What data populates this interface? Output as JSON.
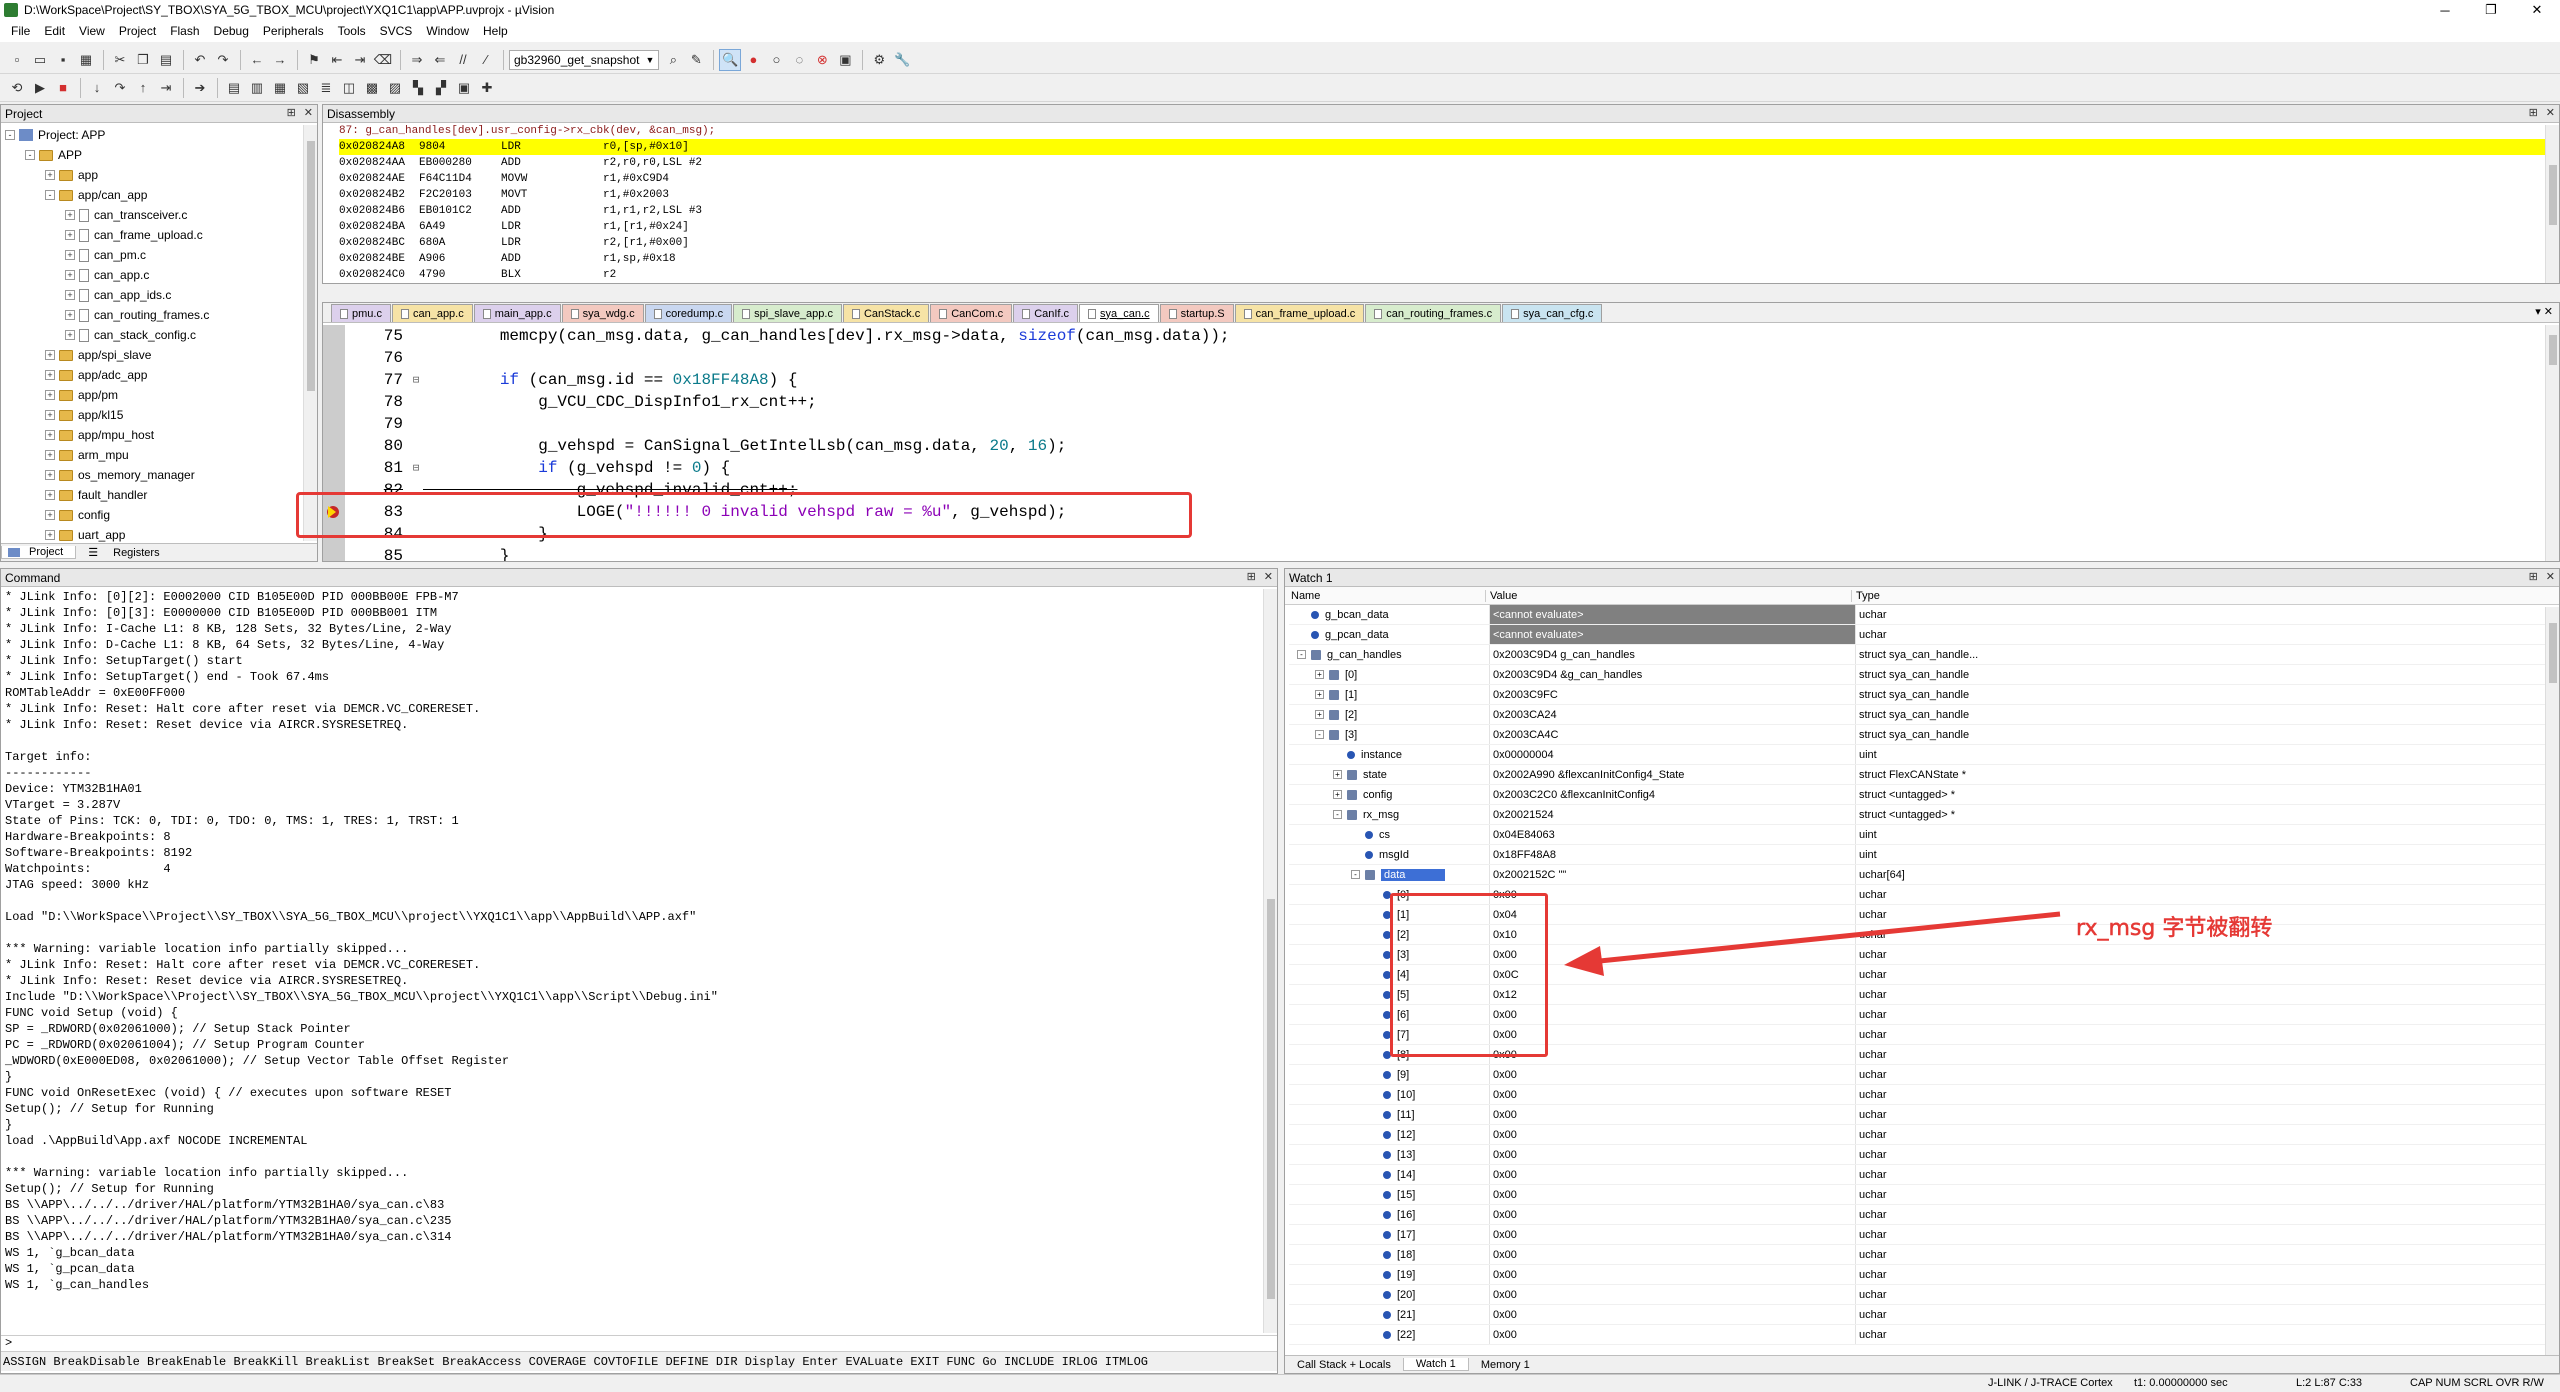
{
  "titlebar": {
    "title": "D:\\WorkSpace\\Project\\SY_TBOX\\SYA_5G_TBOX_MCU\\project\\YXQ1C1\\app\\APP.uvprojx - µVision",
    "minimize": "─",
    "maximize": "❐",
    "close": "✕"
  },
  "menu": [
    "File",
    "Edit",
    "View",
    "Project",
    "Flash",
    "Debug",
    "Peripherals",
    "Tools",
    "SVCS",
    "Window",
    "Help"
  ],
  "toolbar": {
    "target": "gb32960_get_snapshot"
  },
  "project_panel": {
    "title": "Project",
    "tree": [
      {
        "label": "Project: APP",
        "level": 0,
        "kind": "project",
        "exp": "-"
      },
      {
        "label": "APP",
        "level": 1,
        "kind": "folder",
        "exp": "-"
      },
      {
        "label": "app",
        "level": 2,
        "kind": "folder",
        "exp": "+"
      },
      {
        "label": "app/can_app",
        "level": 2,
        "kind": "folder",
        "exp": "-"
      },
      {
        "label": "can_transceiver.c",
        "level": 3,
        "kind": "file",
        "exp": "+"
      },
      {
        "label": "can_frame_upload.c",
        "level": 3,
        "kind": "file",
        "exp": "+"
      },
      {
        "label": "can_pm.c",
        "level": 3,
        "kind": "file",
        "exp": "+"
      },
      {
        "label": "can_app.c",
        "level": 3,
        "kind": "file",
        "exp": "+"
      },
      {
        "label": "can_app_ids.c",
        "level": 3,
        "kind": "file",
        "exp": "+"
      },
      {
        "label": "can_routing_frames.c",
        "level": 3,
        "kind": "file",
        "exp": "+"
      },
      {
        "label": "can_stack_config.c",
        "level": 3,
        "kind": "file",
        "exp": "+"
      },
      {
        "label": "app/spi_slave",
        "level": 2,
        "kind": "folder",
        "exp": "+"
      },
      {
        "label": "app/adc_app",
        "level": 2,
        "kind": "folder",
        "exp": "+"
      },
      {
        "label": "app/pm",
        "level": 2,
        "kind": "folder",
        "exp": "+"
      },
      {
        "label": "app/kl15",
        "level": 2,
        "kind": "folder",
        "exp": "+"
      },
      {
        "label": "app/mpu_host",
        "level": 2,
        "kind": "folder",
        "exp": "+"
      },
      {
        "label": "arm_mpu",
        "level": 2,
        "kind": "folder",
        "exp": "+"
      },
      {
        "label": "os_memory_manager",
        "level": 2,
        "kind": "folder",
        "exp": "+"
      },
      {
        "label": "fault_handler",
        "level": 2,
        "kind": "folder",
        "exp": "+"
      },
      {
        "label": "config",
        "level": 2,
        "kind": "folder",
        "exp": "+"
      },
      {
        "label": "uart_app",
        "level": 2,
        "kind": "folder",
        "exp": "+"
      }
    ],
    "tabs": [
      "Project",
      "Registers"
    ]
  },
  "disassembly": {
    "title": "Disassembly",
    "source_line": "    87:           g_can_handles[dev].usr_config->rx_cbk(dev, &can_msg);",
    "rows": [
      {
        "addr": "0x020824A8",
        "op": "9804",
        "mn": "LDR",
        "args": "r0,[sp,#0x10]",
        "hl": true
      },
      {
        "addr": "0x020824AA",
        "op": "EB000280",
        "mn": "ADD",
        "args": "r2,r0,r0,LSL #2",
        "hl": false
      },
      {
        "addr": "0x020824AE",
        "op": "F64C11D4",
        "mn": "MOVW",
        "args": "r1,#0xC9D4",
        "hl": false
      },
      {
        "addr": "0x020824B2",
        "op": "F2C20103",
        "mn": "MOVT",
        "args": "r1,#0x2003",
        "hl": false
      },
      {
        "addr": "0x020824B6",
        "op": "EB0101C2",
        "mn": "ADD",
        "args": "r1,r1,r2,LSL #3",
        "hl": false
      },
      {
        "addr": "0x020824BA",
        "op": "6A49",
        "mn": "LDR",
        "args": "r1,[r1,#0x24]",
        "hl": false
      },
      {
        "addr": "0x020824BC",
        "op": "680A",
        "mn": "LDR",
        "args": "r2,[r1,#0x00]",
        "hl": false
      },
      {
        "addr": "0x020824BE",
        "op": "A906",
        "mn": "ADD",
        "args": "r1,sp,#0x18",
        "hl": false
      },
      {
        "addr": "0x020824C0",
        "op": "4790",
        "mn": "BLX",
        "args": "r2",
        "hl": false
      }
    ]
  },
  "editor": {
    "tabs": [
      {
        "label": "pmu.c",
        "color": "#dcd0ec"
      },
      {
        "label": "can_app.c",
        "color": "#f6e3a6"
      },
      {
        "label": "main_app.c",
        "color": "#dcd0ec"
      },
      {
        "label": "sya_wdg.c",
        "color": "#f3c9c0"
      },
      {
        "label": "coredump.c",
        "color": "#c9d7f0"
      },
      {
        "label": "spi_slave_app.c",
        "color": "#d7eccd"
      },
      {
        "label": "CanStack.c",
        "color": "#f6e3a6"
      },
      {
        "label": "CanCom.c",
        "color": "#f3c9c0"
      },
      {
        "label": "CanIf.c",
        "color": "#dcd0ec"
      },
      {
        "label": "sya_can.c",
        "color": "#e8e8e8",
        "active": true
      },
      {
        "label": "startup.S",
        "color": "#f3c9c0"
      },
      {
        "label": "can_frame_upload.c",
        "color": "#f6e3a6"
      },
      {
        "label": "can_routing_frames.c",
        "color": "#d7eccd"
      },
      {
        "label": "sya_can_cfg.c",
        "color": "#c9e4f0"
      }
    ],
    "lines": [
      {
        "n": "75",
        "fold": "",
        "code": [
          [
            "        memcpy(can_msg.data, g_can_handles[dev].rx_msg->data, ",
            ""
          ],
          [
            "sizeof",
            "kw"
          ],
          [
            "(can_msg.data));",
            ""
          ]
        ]
      },
      {
        "n": "76",
        "fold": "",
        "code": [
          [
            "",
            ""
          ]
        ]
      },
      {
        "n": "77",
        "fold": "⊟",
        "code": [
          [
            "        ",
            ""
          ],
          [
            "if",
            "kw"
          ],
          [
            " (can_msg.id == ",
            ""
          ],
          [
            "0x18FF48A8",
            "num"
          ],
          [
            ") {",
            ""
          ]
        ]
      },
      {
        "n": "78",
        "fold": "",
        "code": [
          [
            "            g_VCU_CDC_DispInfo1_rx_cnt++;",
            ""
          ]
        ]
      },
      {
        "n": "79",
        "fold": "",
        "code": [
          [
            "",
            ""
          ]
        ]
      },
      {
        "n": "80",
        "fold": "",
        "code": [
          [
            "            g_vehspd = CanSignal_GetIntelLsb(can_msg.data, ",
            ""
          ],
          [
            "20",
            "num"
          ],
          [
            ", ",
            ""
          ],
          [
            "16",
            "num"
          ],
          [
            ");",
            ""
          ]
        ]
      },
      {
        "n": "81",
        "fold": "⊟",
        "code": [
          [
            "            ",
            ""
          ],
          [
            "if",
            "kw"
          ],
          [
            " (g_vehspd != ",
            ""
          ],
          [
            "0",
            "num"
          ],
          [
            ") {",
            ""
          ]
        ]
      },
      {
        "n": "82",
        "fold": "",
        "code": [
          [
            "                g_vehspd_invalid_cnt++;",
            ""
          ]
        ]
      },
      {
        "n": "83",
        "fold": "",
        "code": [
          [
            "                LOGE(",
            ""
          ],
          [
            "\"!!!!!! 0 invalid vehspd raw = %u\"",
            "str"
          ],
          [
            ", g_vehspd);",
            ""
          ]
        ]
      },
      {
        "n": "84",
        "fold": "",
        "code": [
          [
            "            }",
            ""
          ]
        ]
      },
      {
        "n": "85",
        "fold": "",
        "code": [
          [
            "        }",
            ""
          ]
        ]
      }
    ]
  },
  "command": {
    "title": "Command",
    "lines": [
      "* JLink Info: [0][2]: E0002000 CID B105E00D PID 000BB00E FPB-M7",
      "* JLink Info: [0][3]: E0000000 CID B105E00D PID 000BB001 ITM",
      "* JLink Info: I-Cache L1: 8 KB, 128 Sets, 32 Bytes/Line, 2-Way",
      "* JLink Info: D-Cache L1: 8 KB, 64 Sets, 32 Bytes/Line, 4-Way",
      "* JLink Info: SetupTarget() start",
      "* JLink Info: SetupTarget() end - Took 67.4ms",
      "ROMTableAddr = 0xE00FF000",
      "* JLink Info: Reset: Halt core after reset via DEMCR.VC_CORERESET.",
      "* JLink Info: Reset: Reset device via AIRCR.SYSRESETREQ.",
      "",
      "Target info:",
      "------------",
      "Device: YTM32B1HA01",
      "VTarget = 3.287V",
      "State of Pins: TCK: 0, TDI: 0, TDO: 0, TMS: 1, TRES: 1, TRST: 1",
      "Hardware-Breakpoints: 8",
      "Software-Breakpoints: 8192",
      "Watchpoints:          4",
      "JTAG speed: 3000 kHz",
      "",
      "Load \"D:\\\\WorkSpace\\\\Project\\\\SY_TBOX\\\\SYA_5G_TBOX_MCU\\\\project\\\\YXQ1C1\\\\app\\\\AppBuild\\\\APP.axf\"",
      "",
      "*** Warning: variable location info partially skipped...",
      "* JLink Info: Reset: Halt core after reset via DEMCR.VC_CORERESET.",
      "* JLink Info: Reset: Reset device via AIRCR.SYSRESETREQ.",
      "Include \"D:\\\\WorkSpace\\\\Project\\\\SY_TBOX\\\\SYA_5G_TBOX_MCU\\\\project\\\\YXQ1C1\\\\app\\\\Script\\\\Debug.ini\"",
      "FUNC void Setup (void) {",
      "SP = _RDWORD(0x02061000); // Setup Stack Pointer",
      "PC = _RDWORD(0x02061004); // Setup Program Counter",
      "_WDWORD(0xE000ED08, 0x02061000); // Setup Vector Table Offset Register",
      "}",
      "FUNC void OnResetExec (void) { // executes upon software RESET",
      "Setup(); // Setup for Running",
      "}",
      "load .\\AppBuild\\App.axf NOCODE INCREMENTAL",
      "",
      "*** Warning: variable location info partially skipped...",
      "Setup(); // Setup for Running",
      "BS \\\\APP\\../../../driver/HAL/platform/YTM32B1HA0/sya_can.c\\83",
      "BS \\\\APP\\../../../driver/HAL/platform/YTM32B1HA0/sya_can.c\\235",
      "BS \\\\APP\\../../../driver/HAL/platform/YTM32B1HA0/sya_can.c\\314",
      "WS 1, `g_bcan_data",
      "WS 1, `g_pcan_data",
      "WS 1, `g_can_handles"
    ],
    "prompt": ">",
    "hint": "ASSIGN BreakDisable BreakEnable BreakKill BreakList BreakSet BreakAccess COVERAGE COVTOFILE DEFINE DIR Display Enter EVALuate EXIT FUNC Go INCLUDE IRLOG ITMLOG"
  },
  "watch": {
    "title": "Watch 1",
    "headers": [
      "Name",
      "Value",
      "Type"
    ],
    "rows": [
      {
        "name": "g_bcan_data",
        "value": "<cannot evaluate>",
        "type": "uchar",
        "lvl": 0,
        "exp": "",
        "icon": "d",
        "grey": true
      },
      {
        "name": "g_pcan_data",
        "value": "<cannot evaluate>",
        "type": "uchar",
        "lvl": 0,
        "exp": "",
        "icon": "d",
        "grey": true
      },
      {
        "name": "g_can_handles",
        "value": "0x2003C9D4 g_can_handles",
        "type": "struct sya_can_handle...",
        "lvl": 0,
        "exp": "-",
        "icon": "s"
      },
      {
        "name": "[0]",
        "value": "0x2003C9D4 &g_can_handles",
        "type": "struct sya_can_handle",
        "lvl": 1,
        "exp": "+",
        "icon": "s"
      },
      {
        "name": "[1]",
        "value": "0x2003C9FC",
        "type": "struct sya_can_handle",
        "lvl": 1,
        "exp": "+",
        "icon": "s"
      },
      {
        "name": "[2]",
        "value": "0x2003CA24",
        "type": "struct sya_can_handle",
        "lvl": 1,
        "exp": "+",
        "icon": "s"
      },
      {
        "name": "[3]",
        "value": "0x2003CA4C",
        "type": "struct sya_can_handle",
        "lvl": 1,
        "exp": "-",
        "icon": "s"
      },
      {
        "name": "instance",
        "value": "0x00000004",
        "type": "uint",
        "lvl": 2,
        "exp": "",
        "icon": "d"
      },
      {
        "name": "state",
        "value": "0x2002A990 &flexcanInitConfig4_State",
        "type": "struct FlexCANState *",
        "lvl": 2,
        "exp": "+",
        "icon": "s"
      },
      {
        "name": "config",
        "value": "0x2003C2C0 &flexcanInitConfig4",
        "type": "struct <untagged> *",
        "lvl": 2,
        "exp": "+",
        "icon": "s"
      },
      {
        "name": "rx_msg",
        "value": "0x20021524",
        "type": "struct <untagged> *",
        "lvl": 2,
        "exp": "-",
        "icon": "s"
      },
      {
        "name": "cs",
        "value": "0x04E84063",
        "type": "uint",
        "lvl": 3,
        "exp": "",
        "icon": "d"
      },
      {
        "name": "msgId",
        "value": "0x18FF48A8",
        "type": "uint",
        "lvl": 3,
        "exp": "",
        "icon": "d"
      },
      {
        "name": "data",
        "value": "0x2002152C \"\"",
        "type": "uchar[64]",
        "lvl": 3,
        "exp": "-",
        "icon": "s",
        "sel": true
      },
      {
        "name": "[0]",
        "value": "0x00",
        "type": "uchar",
        "lvl": 4,
        "exp": "",
        "icon": "d"
      },
      {
        "name": "[1]",
        "value": "0x04",
        "type": "uchar",
        "lvl": 4,
        "exp": "",
        "icon": "d"
      },
      {
        "name": "[2]",
        "value": "0x10",
        "type": "uchar",
        "lvl": 4,
        "exp": "",
        "icon": "d"
      },
      {
        "name": "[3]",
        "value": "0x00",
        "type": "uchar",
        "lvl": 4,
        "exp": "",
        "icon": "d"
      },
      {
        "name": "[4]",
        "value": "0x0C",
        "type": "uchar",
        "lvl": 4,
        "exp": "",
        "icon": "d"
      },
      {
        "name": "[5]",
        "value": "0x12",
        "type": "uchar",
        "lvl": 4,
        "exp": "",
        "icon": "d"
      },
      {
        "name": "[6]",
        "value": "0x00",
        "type": "uchar",
        "lvl": 4,
        "exp": "",
        "icon": "d"
      },
      {
        "name": "[7]",
        "value": "0x00",
        "type": "uchar",
        "lvl": 4,
        "exp": "",
        "icon": "d"
      },
      {
        "name": "[8]",
        "value": "0x00",
        "type": "uchar",
        "lvl": 4,
        "exp": "",
        "icon": "d"
      },
      {
        "name": "[9]",
        "value": "0x00",
        "type": "uchar",
        "lvl": 4,
        "exp": "",
        "icon": "d"
      },
      {
        "name": "[10]",
        "value": "0x00",
        "type": "uchar",
        "lvl": 4,
        "exp": "",
        "icon": "d"
      },
      {
        "name": "[11]",
        "value": "0x00",
        "type": "uchar",
        "lvl": 4,
        "exp": "",
        "icon": "d"
      },
      {
        "name": "[12]",
        "value": "0x00",
        "type": "uchar",
        "lvl": 4,
        "exp": "",
        "icon": "d"
      },
      {
        "name": "[13]",
        "value": "0x00",
        "type": "uchar",
        "lvl": 4,
        "exp": "",
        "icon": "d"
      },
      {
        "name": "[14]",
        "value": "0x00",
        "type": "uchar",
        "lvl": 4,
        "exp": "",
        "icon": "d"
      },
      {
        "name": "[15]",
        "value": "0x00",
        "type": "uchar",
        "lvl": 4,
        "exp": "",
        "icon": "d"
      },
      {
        "name": "[16]",
        "value": "0x00",
        "type": "uchar",
        "lvl": 4,
        "exp": "",
        "icon": "d"
      },
      {
        "name": "[17]",
        "value": "0x00",
        "type": "uchar",
        "lvl": 4,
        "exp": "",
        "icon": "d"
      },
      {
        "name": "[18]",
        "value": "0x00",
        "type": "uchar",
        "lvl": 4,
        "exp": "",
        "icon": "d"
      },
      {
        "name": "[19]",
        "value": "0x00",
        "type": "uchar",
        "lvl": 4,
        "exp": "",
        "icon": "d"
      },
      {
        "name": "[20]",
        "value": "0x00",
        "type": "uchar",
        "lvl": 4,
        "exp": "",
        "icon": "d"
      },
      {
        "name": "[21]",
        "value": "0x00",
        "type": "uchar",
        "lvl": 4,
        "exp": "",
        "icon": "d"
      },
      {
        "name": "[22]",
        "value": "0x00",
        "type": "uchar",
        "lvl": 4,
        "exp": "",
        "icon": "d"
      }
    ],
    "tabs": [
      "Call Stack + Locals",
      "Watch 1",
      "Memory 1"
    ],
    "annotation": "rx_msg 字节被翻转"
  },
  "statusbar": {
    "debugger": "J-LINK / J-TRACE Cortex",
    "time": "t1: 0.00000000 sec",
    "pos": "L:2 L:87 C:33",
    "flags": "CAP NUM SCRL OVR R/W"
  },
  "colors": {
    "annotation_red": "#e53935",
    "pc_highlight": "#ffff00",
    "selected": "#3d6fd6"
  }
}
